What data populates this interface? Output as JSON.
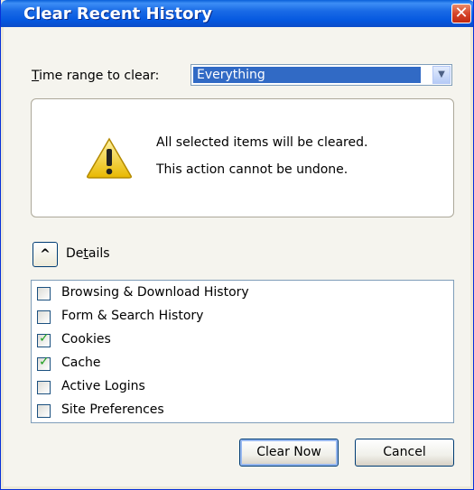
{
  "window": {
    "title": "Clear Recent History",
    "close_icon": "close-icon"
  },
  "time_range": {
    "label_prefix": "",
    "label_accel": "T",
    "label_rest": "ime range to clear:",
    "selected": "Everything"
  },
  "warning": {
    "icon": "warning-icon",
    "line1": "All selected items will be cleared.",
    "line2": "This action cannot be undone."
  },
  "details": {
    "label_prefix": "De",
    "label_accel": "t",
    "label_rest": "ails",
    "toggle_icon": "chevron-up-icon"
  },
  "items": [
    {
      "label": "Browsing & Download History",
      "checked": false
    },
    {
      "label": "Form & Search History",
      "checked": false
    },
    {
      "label": "Cookies",
      "checked": true
    },
    {
      "label": "Cache",
      "checked": true
    },
    {
      "label": "Active Logins",
      "checked": false
    },
    {
      "label": "Site Preferences",
      "checked": false
    }
  ],
  "buttons": {
    "clear_now": "Clear Now",
    "cancel": "Cancel"
  },
  "colors": {
    "titlebar": "#0558e0",
    "selection": "#316ac5",
    "checkmark": "#21a121",
    "close": "#d6452a"
  }
}
